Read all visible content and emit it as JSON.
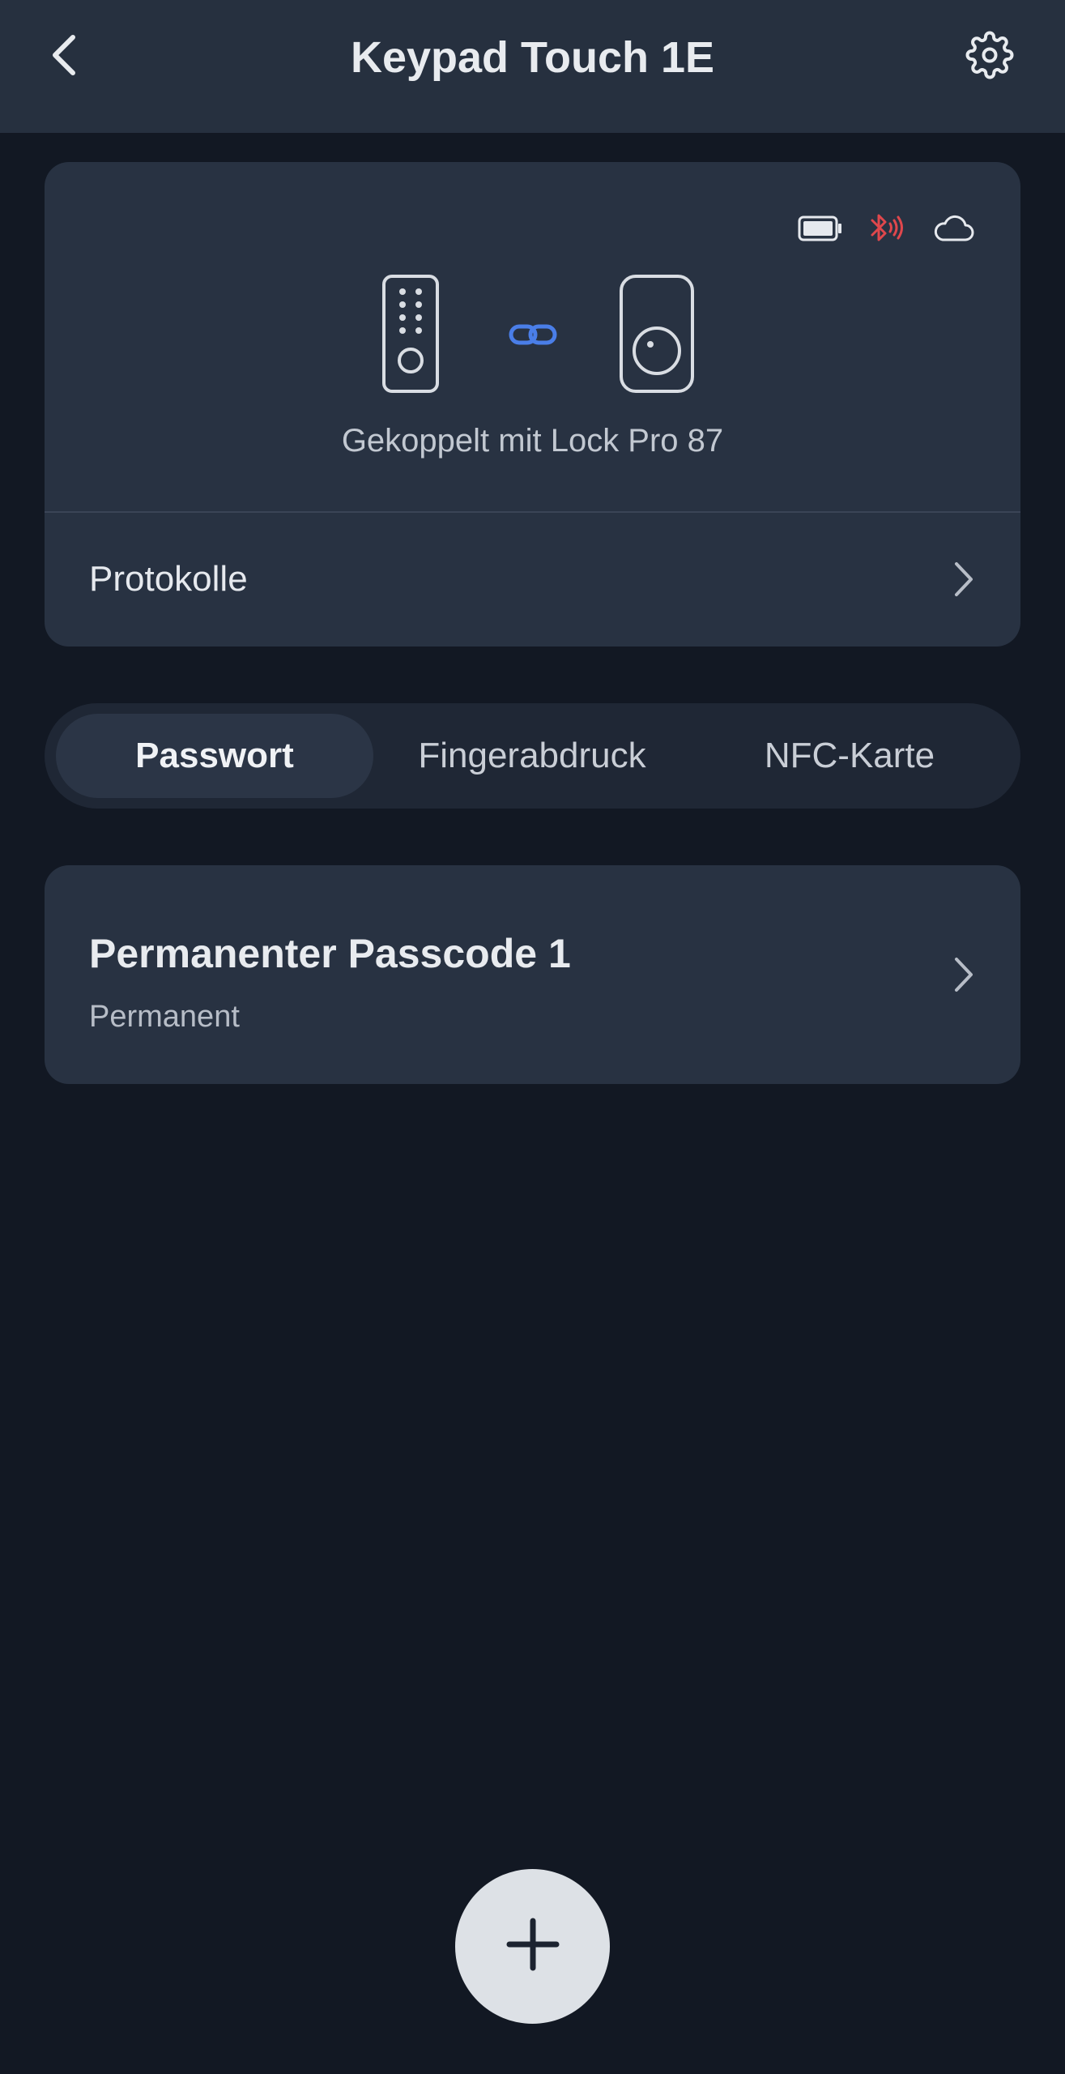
{
  "header": {
    "title": "Keypad Touch 1E",
    "back_icon": "chevron-left-icon",
    "settings_icon": "gear-icon"
  },
  "device_card": {
    "status_icons": [
      "battery-icon",
      "bluetooth-icon",
      "cloud-icon"
    ],
    "bluetooth_color": "#e0474c",
    "link_color": "#4a7ee8",
    "paired_text": "Gekoppelt mit Lock Pro 87",
    "logs_label": "Protokolle"
  },
  "tabs": [
    {
      "label": "Passwort",
      "active": true
    },
    {
      "label": "Fingerabdruck",
      "active": false
    },
    {
      "label": "NFC-Karte",
      "active": false
    }
  ],
  "passcodes": [
    {
      "title": "Permanenter Passcode 1",
      "subtitle": "Permanent"
    }
  ],
  "fab": {
    "icon": "plus-icon"
  }
}
